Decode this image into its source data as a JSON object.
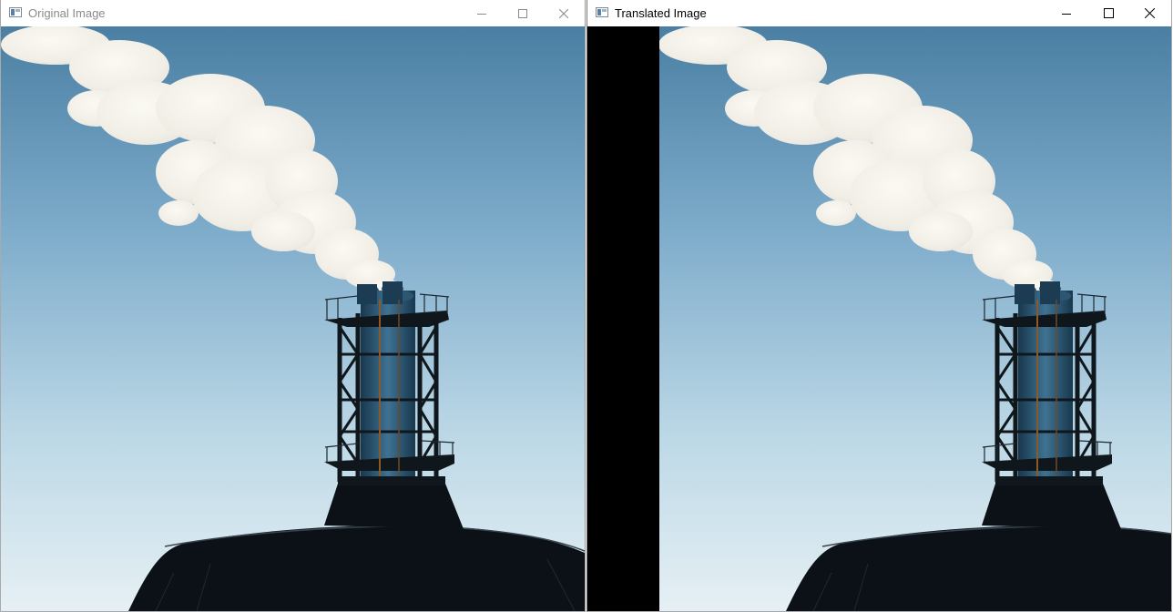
{
  "windows": {
    "original": {
      "title": "Original Image",
      "active": false,
      "icons": {
        "app": "app-window-icon",
        "minimize": "minimize-icon",
        "maximize": "maximize-icon",
        "close": "close-icon"
      }
    },
    "translated": {
      "title": "Translated Image",
      "active": true,
      "icons": {
        "app": "app-window-icon",
        "minimize": "minimize-icon",
        "maximize": "maximize-icon",
        "close": "close-icon"
      }
    }
  },
  "colors": {
    "sky_top": "#4a7fa3",
    "sky_mid": "#8fbad4",
    "sky_bottom": "#e4eff4",
    "smoke": "#f6f3ec",
    "silhouette": "#0b1116",
    "tower_steel": "#121a20",
    "tower_tank": "#2f5e7c",
    "translation_fill": "#000000",
    "inactive_title": "#8a8a8a",
    "active_title": "#000000"
  }
}
